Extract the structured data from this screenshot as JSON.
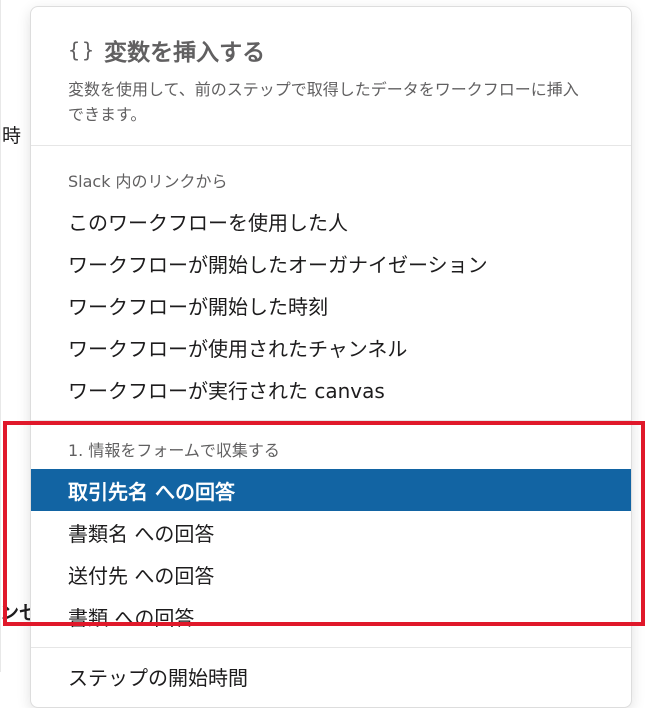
{
  "background": {
    "left_fragment": "時",
    "bottom_fragment": "ンセ"
  },
  "panel": {
    "icon": "curly-braces-icon",
    "title": "変数を挿入する",
    "subtitle": "変数を使用して、前のステップで取得したデータをワークフローに挿入できます。",
    "sections": [
      {
        "label": "Slack 内のリンクから",
        "items": [
          "このワークフローを使用した人",
          "ワークフローが開始したオーガナイゼーション",
          "ワークフローが開始した時刻",
          "ワークフローが使用されたチャンネル",
          "ワークフローが実行された canvas"
        ]
      },
      {
        "label": "1. 情報をフォームで収集する",
        "items": [
          "取引先名 への回答",
          "書類名 への回答",
          "送付先 への回答",
          "書類 への回答"
        ]
      }
    ],
    "partial_label": "ステップの開始時間"
  },
  "colors": {
    "selected_bg": "#1264a3",
    "highlight_border": "#e0182a",
    "muted_text": "#616061"
  }
}
